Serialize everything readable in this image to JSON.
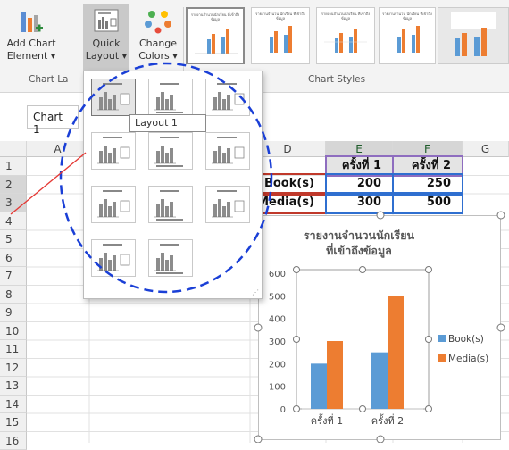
{
  "ribbon": {
    "add_chart_element": [
      "Add Chart",
      "Element ▾"
    ],
    "quick_layout": [
      "Quick",
      "Layout ▾"
    ],
    "change_colors": [
      "Change",
      "Colors ▾"
    ],
    "group_chart_layouts": "Chart La",
    "group_chart_styles": "Chart Styles",
    "style_thumb_titles": [
      "รายงานจำนวนนักเรียน ที่เข้าถึงข้อมูล",
      "รายงานจำนวน นักเรียน ที่เข้าถึงข้อมูล",
      "รายงานจำนวนนักเรียน ที่เข้าถึงข้อมูล",
      "รายงานจำนวน นักเรียน ที่เข้าถึงข้อมูล"
    ]
  },
  "name_box": "Chart 1",
  "tooltip": "Layout 1",
  "columns": [
    "A",
    "D",
    "E",
    "F",
    "G"
  ],
  "rows": [
    "1",
    "2",
    "3",
    "4",
    "5",
    "6",
    "7",
    "8",
    "9",
    "10",
    "11",
    "12",
    "13",
    "14",
    "15",
    "16"
  ],
  "sheet": {
    "header_row": {
      "e": "ครั้งที่ 1",
      "f": "ครั้งที่ 2"
    },
    "row2": {
      "d": "Book(s)",
      "e": "200",
      "f": "250"
    },
    "row3": {
      "d": "Media(s)",
      "e": "300",
      "f": "500"
    }
  },
  "colors": {
    "book": "#5b9bd5",
    "media": "#ed7d31",
    "excel_green": "#217346"
  },
  "chart_data": {
    "type": "bar",
    "title": "รายงานจำนวนนักเรียน ที่เข้าถึงข้อมูล",
    "title_lines": [
      "รายงานจำนวนนักเรียน",
      "ที่เข้าถึงข้อมูล"
    ],
    "categories": [
      "ครั้งที่ 1",
      "ครั้งที่ 2"
    ],
    "series": [
      {
        "name": "Book(s)",
        "values": [
          200,
          250
        ],
        "color": "#5b9bd5"
      },
      {
        "name": "Media(s)",
        "values": [
          300,
          500
        ],
        "color": "#ed7d31"
      }
    ],
    "ylim": [
      0,
      600
    ],
    "yticks": [
      "0",
      "100",
      "200",
      "300",
      "400",
      "500",
      "600"
    ],
    "legend": "right",
    "grid": false
  }
}
